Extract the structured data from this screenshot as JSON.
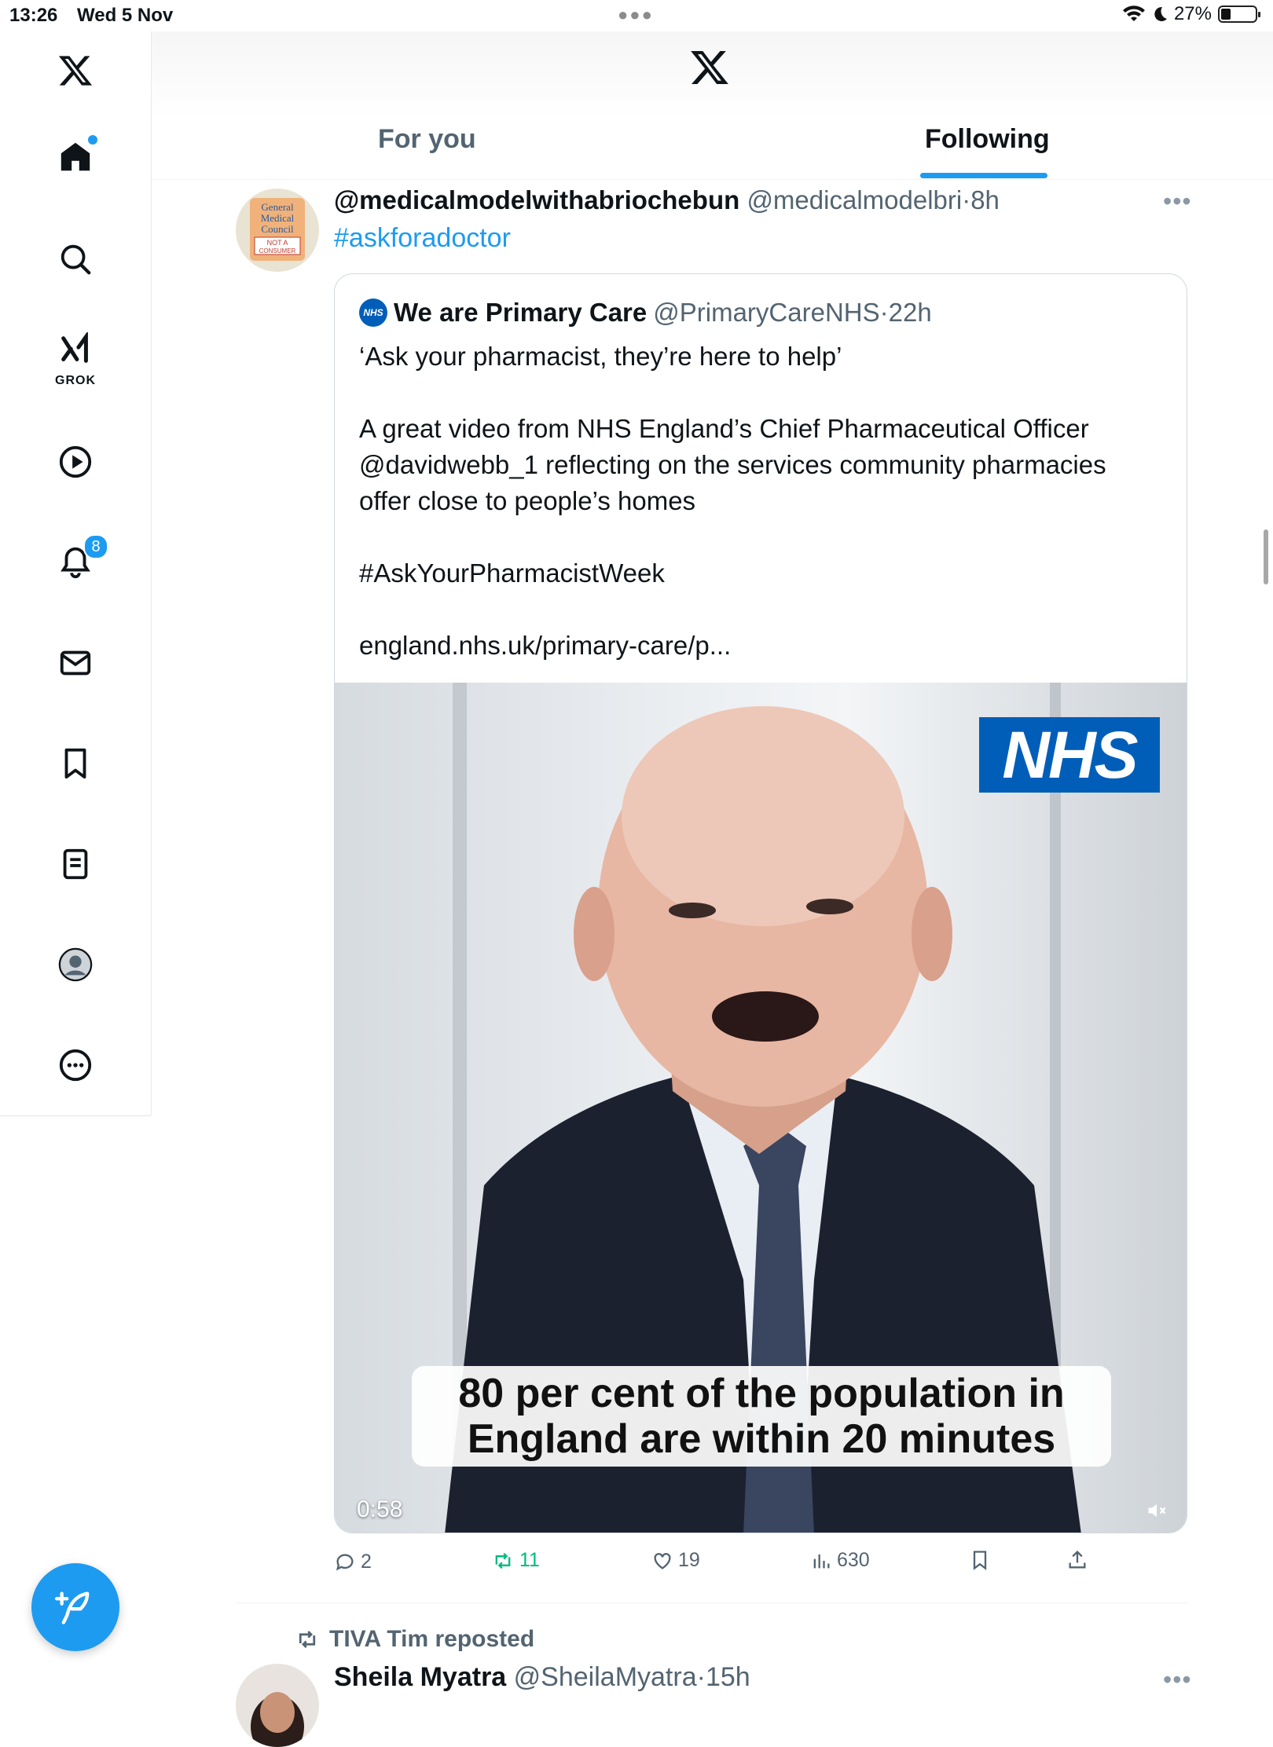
{
  "status_bar": {
    "time": "13:26",
    "date": "Wed 5 Nov",
    "battery": "27%"
  },
  "header": {
    "tabs": [
      "For you",
      "Following"
    ],
    "active_tab": "Following"
  },
  "sidebar": {
    "items": [
      "x-logo",
      "home",
      "search",
      "grok",
      "video",
      "notifications",
      "messages",
      "bookmarks",
      "lists",
      "profile",
      "more"
    ],
    "grok_label": "GROK",
    "notifications_badge": "8"
  },
  "tweet": {
    "name": "@medicalmodelwithabriochebun",
    "handle": "@medicalmodelbri",
    "separator": "·",
    "time": "8h",
    "hashtag": "#askforadoctor",
    "avatar_text": [
      "General",
      "Medical",
      "Council",
      "NOT A",
      "CONSUMER"
    ],
    "quote": {
      "badge_text": "NHS",
      "name": "We are Primary Care",
      "handle": "@PrimaryCareNHS",
      "separator": "·",
      "time": "22h",
      "lines": {
        "l1": "‘Ask your pharmacist, they’re here to help’",
        "l2": "A great video from NHS England’s Chief Pharmaceutical Officer",
        "l3": "@davidwebb_1 reflecting on the services community pharmacies",
        "l4": "offer close to people’s homes",
        "l5": "#AskYourPharmacistWeek",
        "l6": "england.nhs.uk/primary-care/p..."
      },
      "video": {
        "logo": "NHS",
        "caption_line1": "80 per cent of the population in",
        "caption_line2": "England are within 20 minutes",
        "duration": "0:58"
      }
    },
    "actions": {
      "replies": "2",
      "reposts": "11",
      "likes": "19",
      "views": "630"
    }
  },
  "next_tweet": {
    "repost_label": "TIVA Tim reposted",
    "name": "Sheila Myatra",
    "handle": "@SheilaMyatra",
    "separator": "·",
    "time": "15h"
  },
  "colors": {
    "accent": "#1d9bf0",
    "repost_green": "#00ba7c",
    "nhs_blue": "#005eb8"
  }
}
